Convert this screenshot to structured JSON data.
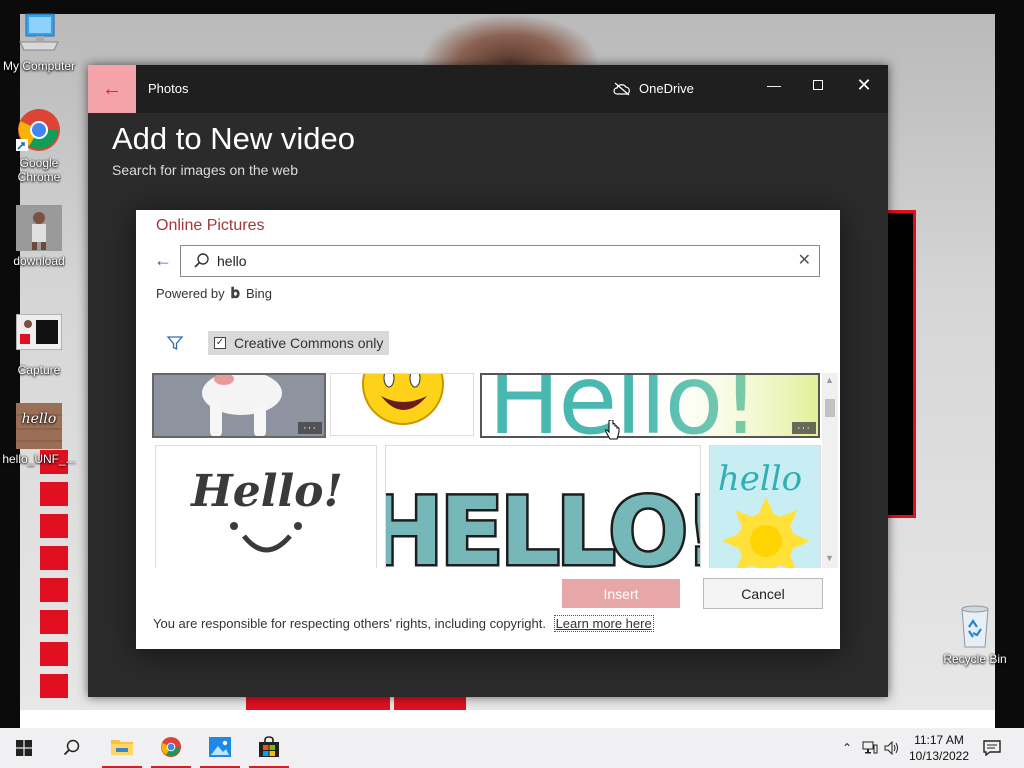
{
  "desktop": {
    "icons": [
      {
        "label": "My Computer"
      },
      {
        "label": "Google Chrome"
      },
      {
        "label": "download"
      },
      {
        "label": "Capture"
      },
      {
        "label": "hello_UNF_..."
      },
      {
        "label": "Recycle Bin"
      }
    ]
  },
  "window": {
    "app_name": "Photos",
    "onedrive_label": "OneDrive",
    "page_title": "Add to New video",
    "page_subtitle": "Search for images on the web"
  },
  "dialog": {
    "title": "Online Pictures",
    "search": {
      "value": "hello"
    },
    "powered_by": "Powered by",
    "bing_label": "Bing",
    "filter_chip_label": "Creative Commons only",
    "filter_checked": true,
    "tiles": [
      {
        "desc": "white dog"
      },
      {
        "desc": "smiley face"
      },
      {
        "desc": "Hello teal-green lettering"
      },
      {
        "text": "Hello!"
      },
      {
        "text": "HELLO!"
      },
      {
        "text": "hello"
      }
    ],
    "more_label": "···",
    "insert_label": "Insert",
    "cancel_label": "Cancel",
    "rights_text": "You are responsible for respecting others' rights, including copyright.",
    "learn_more": "Learn more here"
  },
  "taskbar": {
    "time": "11:17 AM",
    "date": "10/13/2022"
  },
  "colors": {
    "accent_red": "#d21f2a",
    "dialog_title": "#a4373a",
    "link_blue": "#2b6cb0"
  }
}
